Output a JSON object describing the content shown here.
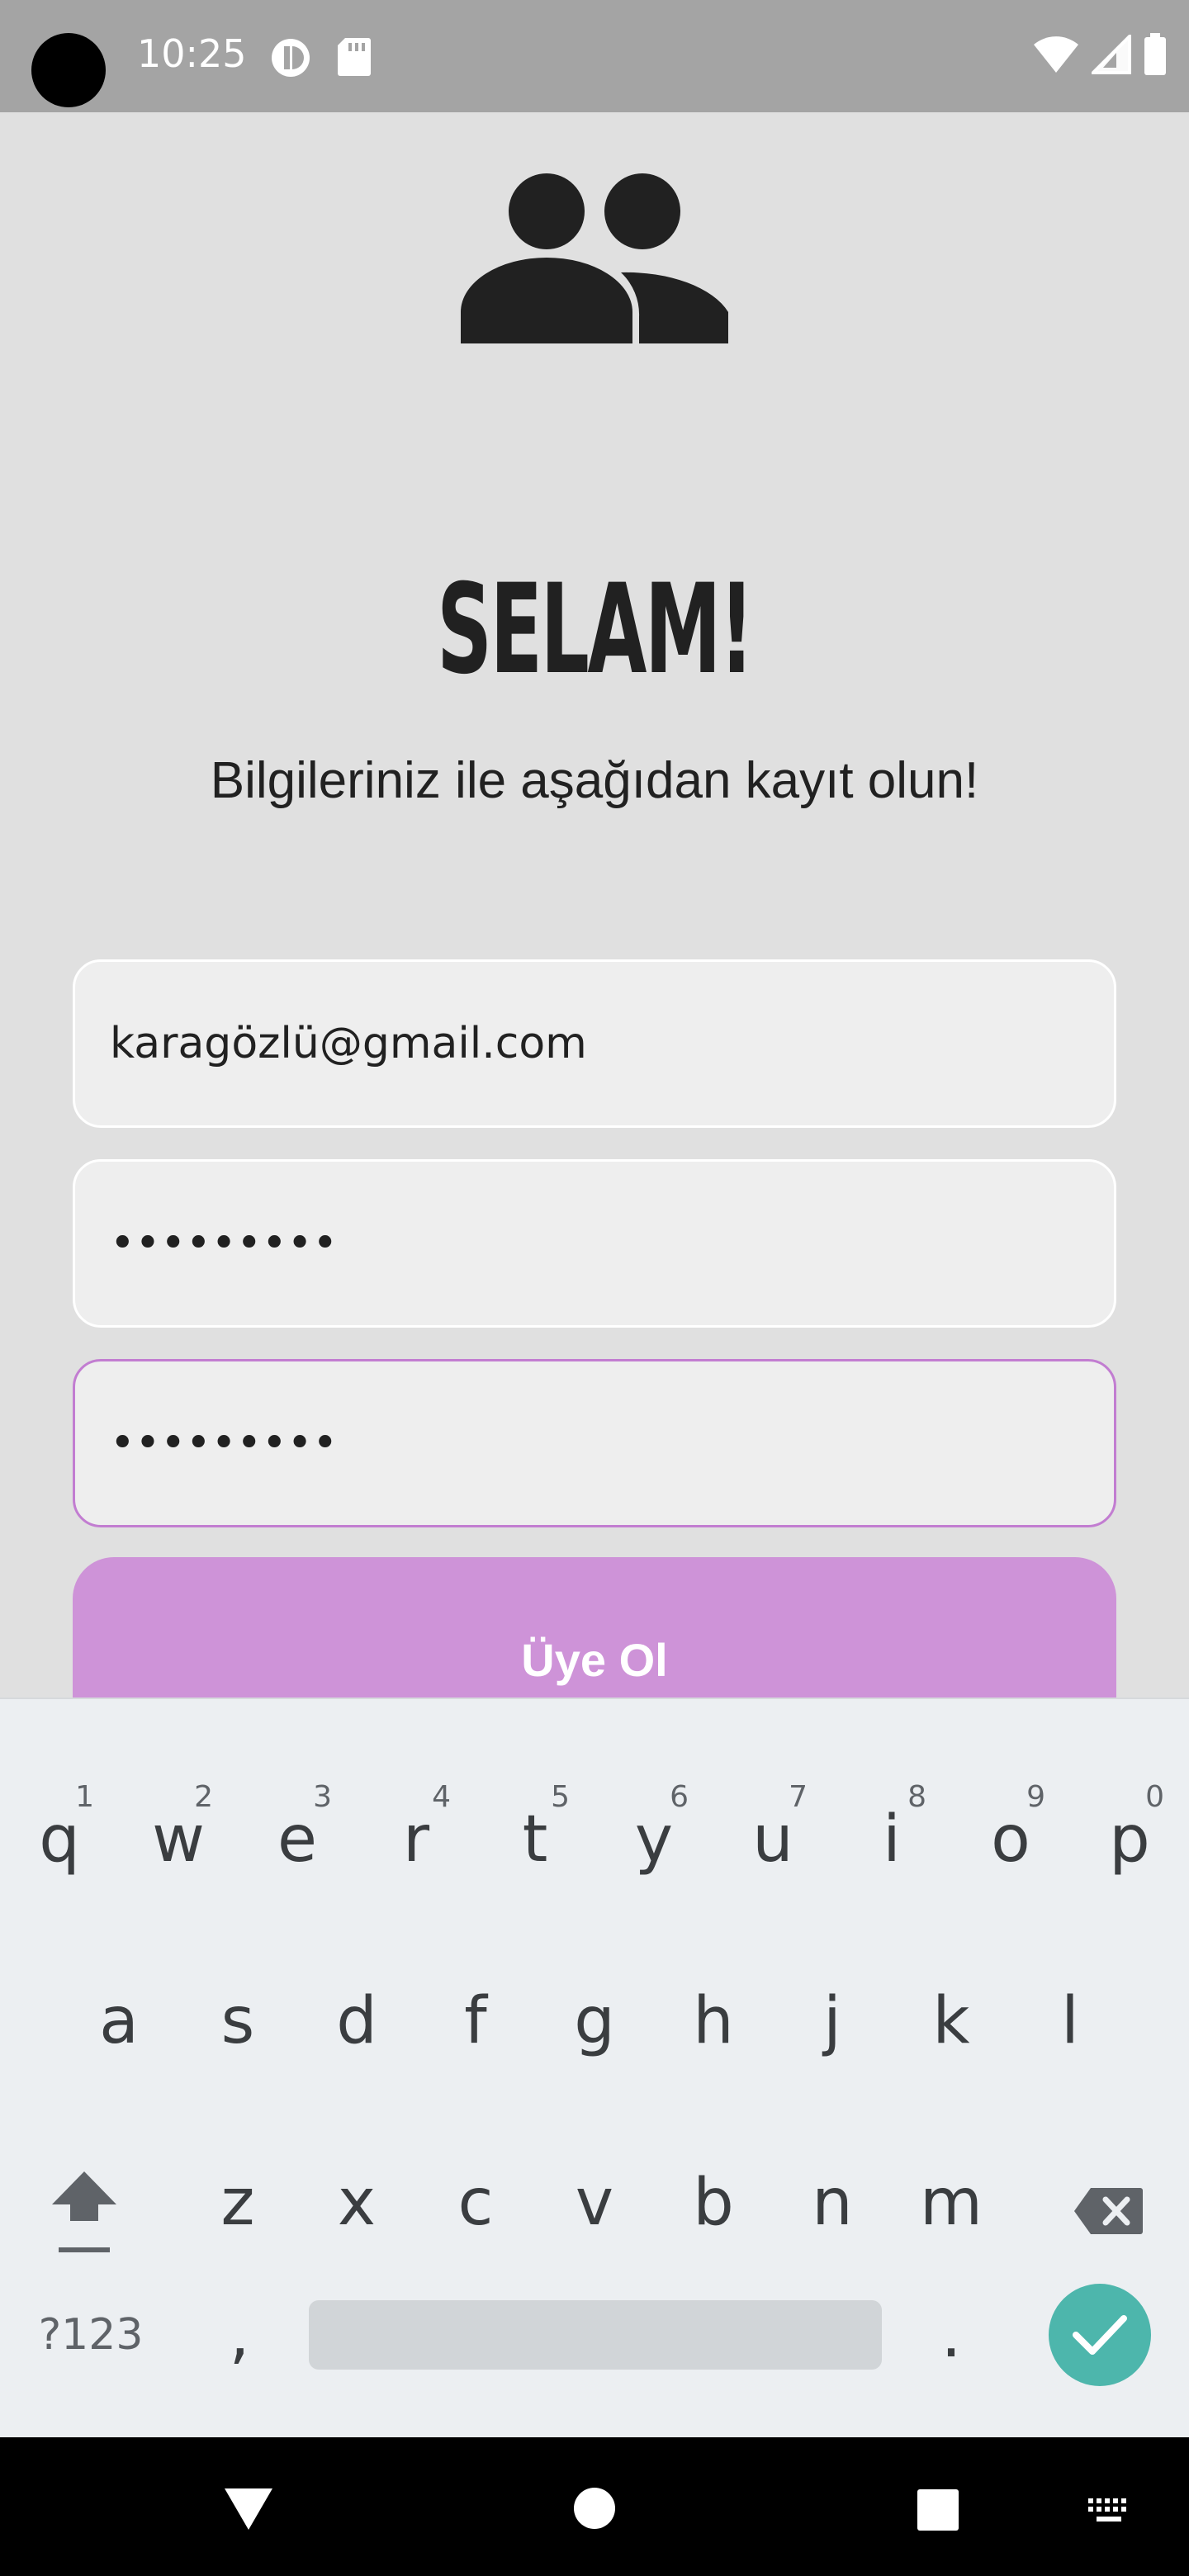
{
  "status_bar": {
    "time": "10:25"
  },
  "signup": {
    "title": "SELAM!",
    "subtitle": "Bilgileriniz ile aşağıdan kayıt olun!",
    "email_value": "karagözlü@gmail.com",
    "password_value": "•••••••••",
    "confirm_password_value": "•••••••••",
    "button_label": "Üye Ol"
  },
  "keyboard": {
    "row1": [
      {
        "k": "q",
        "n": "1"
      },
      {
        "k": "w",
        "n": "2"
      },
      {
        "k": "e",
        "n": "3"
      },
      {
        "k": "r",
        "n": "4"
      },
      {
        "k": "t",
        "n": "5"
      },
      {
        "k": "y",
        "n": "6"
      },
      {
        "k": "u",
        "n": "7"
      },
      {
        "k": "i",
        "n": "8"
      },
      {
        "k": "o",
        "n": "9"
      },
      {
        "k": "p",
        "n": "0"
      }
    ],
    "row2": [
      "a",
      "s",
      "d",
      "f",
      "g",
      "h",
      "j",
      "k",
      "l"
    ],
    "row3": [
      "z",
      "x",
      "c",
      "v",
      "b",
      "n",
      "m"
    ],
    "symbols_label": "?123",
    "comma": ",",
    "period": "."
  },
  "colors": {
    "accent": "#ce93d8",
    "focus_border": "#c27dd1",
    "enter_key": "#4db6ac"
  }
}
